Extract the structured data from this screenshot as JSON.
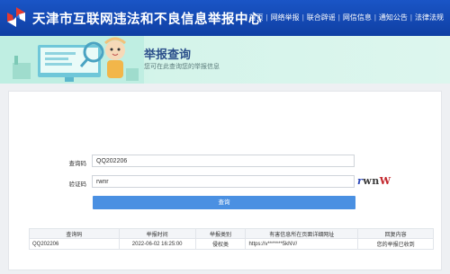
{
  "header": {
    "site_title": "天津市互联网违法和不良信息举报中心",
    "nav": [
      "首页",
      "网络举报",
      "联合辟谣",
      "网信信息",
      "通知公告",
      "法律法规"
    ]
  },
  "banner": {
    "title": "举报查询",
    "subtitle": "您可在此查询您的举报信息"
  },
  "form": {
    "query_code_label": "查询码",
    "query_code_value": "QQ202206",
    "captcha_label": "验证码",
    "captcha_value": "rwnr",
    "captcha_image_text": [
      "r",
      "wn",
      "W"
    ],
    "submit_label": "查询"
  },
  "results": {
    "columns": [
      "查询码",
      "举报时间",
      "举报类别",
      "有害信息所在页面详细网址",
      "回复内容"
    ],
    "rows": [
      [
        "QQ202206",
        "2022-06-02 16:25:00",
        "侵权类",
        "https://v*******5kNV/",
        "您的举报已收到"
      ]
    ]
  },
  "colors": {
    "header_blue": "#1a55c6",
    "button_blue": "#4a90e2",
    "banner_green": "#ddf6ee"
  }
}
